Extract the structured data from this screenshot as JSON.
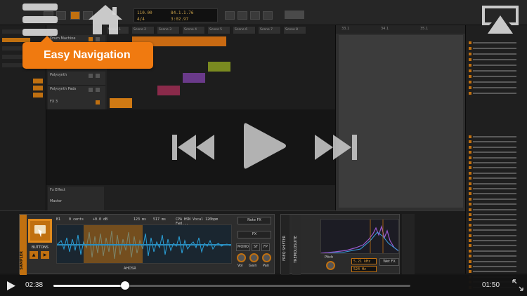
{
  "tooltip": {
    "text": "Easy Navigation"
  },
  "daw": {
    "transport": {
      "tempo": "110.00",
      "position": "84.1.1.76",
      "signature": "4/4",
      "time": "3:02.97"
    },
    "scenes": [
      "Scene 1",
      "Scene 2",
      "Scene 3",
      "Scene 4",
      "Scene 5",
      "Scene 6",
      "Scene 7",
      "Scene 8"
    ],
    "tracks": [
      "Drum Machine",
      "Polysynth",
      "Polysynth Pads",
      "FX 3"
    ],
    "fx_tracks": [
      "Fx Effect",
      "Master"
    ],
    "arranger_ruler": [
      "33.1",
      "34.1",
      "35.1"
    ],
    "sampler": {
      "title": "SAMPLER",
      "buttons_label": "BUTTONS",
      "file": "CPA HSN Vocal 120bpm Fwd...",
      "info": [
        "B1",
        "0 cents",
        "+0.0 dB",
        "123 ms",
        "517 ms"
      ],
      "note_fx": "Note FX",
      "fx": "FX",
      "modes": [
        "MONO",
        "ST",
        "FP"
      ],
      "knobs": [
        "Vol",
        "Gain",
        "Pan"
      ],
      "adsr": "AHDSR"
    },
    "freq_shifter": {
      "strips": [
        "FREQ SHIFTER",
        "TREMOLOSUITE"
      ],
      "values": [
        "5.21 kHz",
        "524 Hz"
      ],
      "knob": "Pitch",
      "note_fx": "Wet FX"
    }
  },
  "overlay": {
    "icons": {
      "menu": "menu-icon",
      "home": "home-icon",
      "airplay": "airplay-icon",
      "rewind": "rewind-icon",
      "play": "play-icon",
      "fast_forward": "fast-forward-icon",
      "fullscreen": "fullscreen-icon"
    }
  },
  "player": {
    "elapsed": "02:38",
    "remaining": "01:50",
    "progress": 0.2
  },
  "colors": {
    "accent": "#f07a10",
    "bitwig_orange": "#c07010",
    "controls": "#d7d7d7"
  }
}
